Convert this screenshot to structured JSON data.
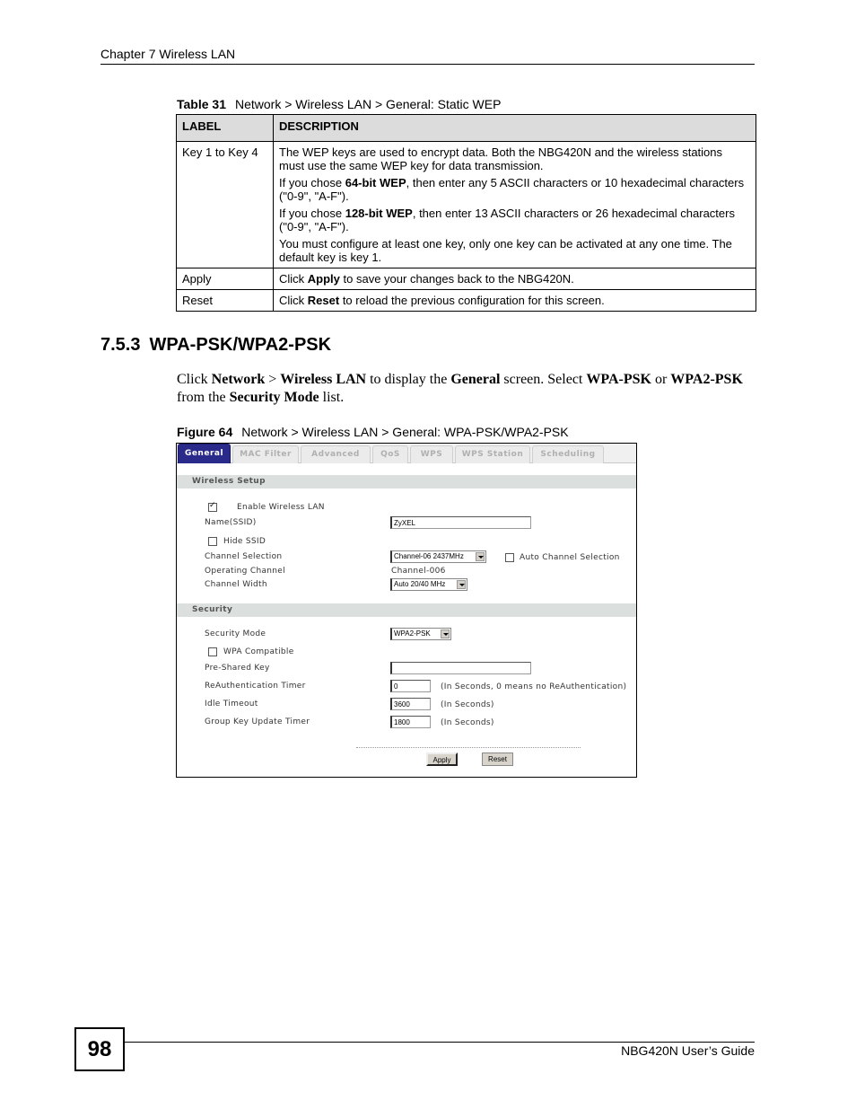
{
  "page": {
    "running_header": "Chapter 7 Wireless LAN",
    "page_number": "98",
    "footer_title": "NBG420N User’s Guide"
  },
  "table": {
    "caption_label": "Table 31",
    "caption_text": "Network > Wireless LAN > General: Static WEP",
    "headers": [
      "LABEL",
      "DESCRIPTION"
    ],
    "rows": [
      {
        "label": "Key 1 to Key 4",
        "paragraphs": [
          {
            "pre": "The WEP keys are used to encrypt data. Both the NBG420N and the wireless stations must use the same WEP key for data transmission.",
            "bold": "",
            "post": ""
          },
          {
            "pre": "If you chose ",
            "bold": "64-bit WEP",
            "post": ", then enter any 5 ASCII characters or 10 hexadecimal characters (\"0-9\", \"A-F\")."
          },
          {
            "pre": "If you chose ",
            "bold": "128-bit WEP",
            "post": ", then enter 13 ASCII characters or 26 hexadecimal characters (\"0-9\", \"A-F\")."
          },
          {
            "pre": "You must configure at least one key, only one key can be activated at any one time. The default key is key 1.",
            "bold": "",
            "post": ""
          }
        ]
      },
      {
        "label": "Apply",
        "paragraphs": [
          {
            "pre": "Click ",
            "bold": "Apply",
            "post": " to save your changes back to the NBG420N."
          }
        ]
      },
      {
        "label": "Reset",
        "paragraphs": [
          {
            "pre": "Click ",
            "bold": "Reset",
            "post": " to reload the previous configuration for this screen."
          }
        ]
      }
    ]
  },
  "section": {
    "number": "7.5.3",
    "title": "WPA-PSK/WPA2-PSK",
    "para": {
      "t1": "Click ",
      "b1": "Network",
      "t2": " > ",
      "b2": "Wireless LAN",
      "t3": " to display the ",
      "b3": "General",
      "t4": " screen. Select ",
      "b4": "WPA-PSK",
      "t5": " or ",
      "b5": "WPA2-PSK",
      "t6": " from the ",
      "b6": "Security Mode",
      "t7": " list."
    }
  },
  "figure": {
    "caption_label": "Figure 64",
    "caption_text": "Network > Wireless LAN > General: WPA-PSK/WPA2-PSK",
    "tabs": [
      "General",
      "MAC Filter",
      "Advanced",
      "QoS",
      "WPS",
      "WPS Station",
      "Scheduling"
    ],
    "active_tab": "General",
    "wireless_setup": {
      "title": "Wireless Setup",
      "enable_wireless_label": "Enable Wireless LAN",
      "enable_wireless_checked": true,
      "ssid_label": "Name(SSID)",
      "ssid_value": "ZyXEL",
      "hide_ssid_label": "Hide SSID",
      "hide_ssid_checked": false,
      "channel_selection_label": "Channel Selection",
      "channel_selection_value": "Channel-06 2437MHz",
      "auto_channel_label": "Auto Channel Selection",
      "auto_channel_checked": false,
      "operating_channel_label": "Operating Channel",
      "operating_channel_value": "Channel-006",
      "channel_width_label": "Channel Width",
      "channel_width_value": "Auto 20/40 MHz"
    },
    "security": {
      "title": "Security",
      "security_mode_label": "Security Mode",
      "security_mode_value": "WPA2-PSK",
      "wpa_compatible_label": "WPA Compatible",
      "wpa_compatible_checked": false,
      "psk_label": "Pre-Shared Key",
      "psk_value": "",
      "reauth_label": "ReAuthentication Timer",
      "reauth_value": "0",
      "reauth_hint": "(In Seconds, 0 means no ReAuthentication)",
      "idle_label": "Idle Timeout",
      "idle_value": "3600",
      "idle_hint": "(In Seconds)",
      "group_key_label": "Group Key Update Timer",
      "group_key_value": "1800",
      "group_key_hint": "(In Seconds)"
    },
    "buttons": {
      "apply": "Apply",
      "reset": "Reset"
    }
  }
}
